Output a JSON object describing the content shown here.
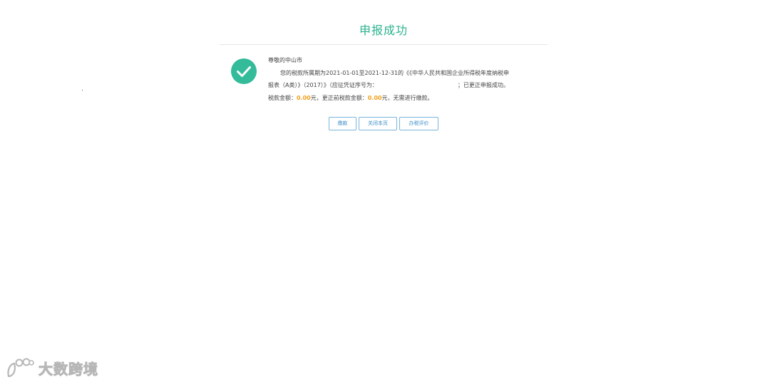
{
  "title": "申报成功",
  "message": {
    "greeting": "尊敬的中山市",
    "line1": "您的税款所属期为2021-01-01至2021-12-31的《《中华人民共和国企业所得税年度纳税申",
    "line2_start": "报表（A类）》（2017）》（应征凭证序号为：",
    "line2_end": "；已更正申报成功。",
    "line3_label_tax": "税款金额：",
    "tax_amount": "0.00",
    "line3_unit1": "元，更正前税款金额：",
    "prev_amount": "0.00",
    "line3_unit2": "元，无需进行缴款。"
  },
  "buttons": {
    "pay": "缴款",
    "close": "关闭本页",
    "evaluate": "办税评价"
  },
  "watermark": {
    "text": "大数跨境"
  },
  "colors": {
    "title": "#2bb28e",
    "check": "#33bb9a",
    "amount": "#f2a01d",
    "button_border": "#79b5db",
    "button_text": "#3d8fc7"
  },
  "icons": {
    "success": "check-circle-icon",
    "watermark_logo": "logo-icon"
  }
}
